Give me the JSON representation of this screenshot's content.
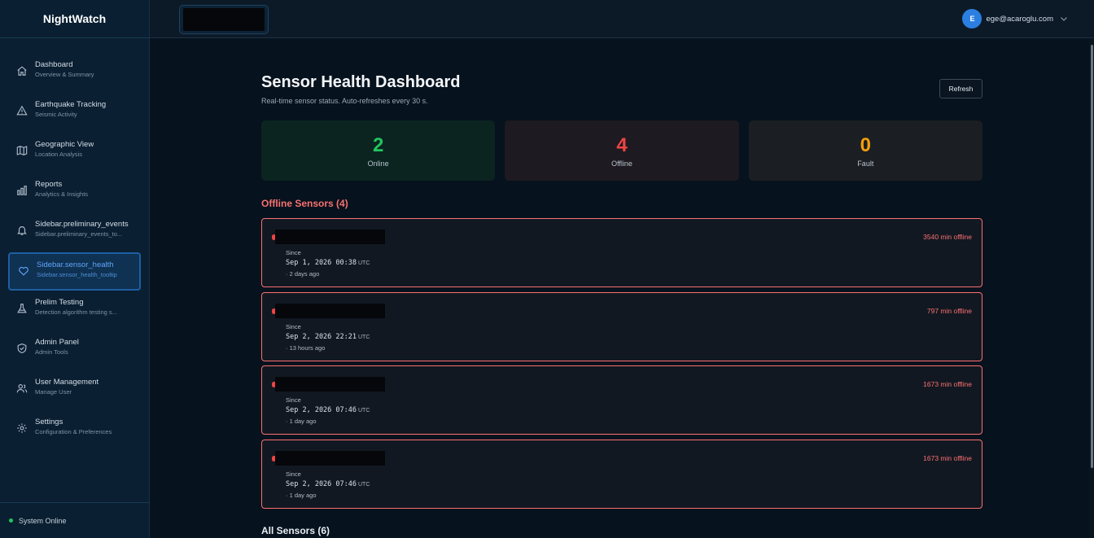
{
  "sidebar": {
    "brand": "NightWatch",
    "items": [
      {
        "title": "Dashboard",
        "subtitle": "Overview & Summary",
        "icon": "home-icon"
      },
      {
        "title": "Earthquake Tracking",
        "subtitle": "Seismic Activity",
        "icon": "warning-triangle-icon"
      },
      {
        "title": "Geographic View",
        "subtitle": "Location Analysis",
        "icon": "map-icon"
      },
      {
        "title": "Reports",
        "subtitle": "Analytics & Insights",
        "icon": "bar-chart-icon"
      },
      {
        "title": "Sidebar.preliminary_events",
        "subtitle": "Sidebar.preliminary_events_to...",
        "icon": "bell-icon"
      },
      {
        "title": "Sidebar.sensor_health",
        "subtitle": "Sidebar.sensor_health_tooltip",
        "icon": "heart-icon",
        "active": true
      },
      {
        "title": "Prelim Testing",
        "subtitle": "Detection algorithm testing s...",
        "icon": "flask-icon"
      },
      {
        "title": "Admin Panel",
        "subtitle": "Admin Tools",
        "icon": "shield-check-icon"
      },
      {
        "title": "User Management",
        "subtitle": "Manage User",
        "icon": "users-icon"
      },
      {
        "title": "Settings",
        "subtitle": "Configuration & Preferences",
        "icon": "gear-icon"
      }
    ],
    "status": "System Online"
  },
  "header": {
    "user_initial": "E",
    "user_email": "ege@acaroglu.com"
  },
  "main": {
    "title": "Sensor Health Dashboard",
    "subtitle": "Real-time sensor status. Auto-refreshes every 30 s.",
    "refresh_label": "Refresh",
    "stats": [
      {
        "value": "2",
        "label": "Online",
        "color": "#22c55e"
      },
      {
        "value": "4",
        "label": "Offline",
        "color": "#ef4444"
      },
      {
        "value": "0",
        "label": "Fault",
        "color": "#f59e0b"
      }
    ],
    "offline_title": "Offline Sensors (4)",
    "offline_sensors": [
      {
        "since_label": "Since",
        "date": "Sep 1, 2026 00:38",
        "tz": "UTC",
        "ago": "· 2 days ago",
        "offline": "3540 min offline"
      },
      {
        "since_label": "Since",
        "date": "Sep 2, 2026 22:21",
        "tz": "UTC",
        "ago": "· 13 hours ago",
        "offline": "797 min offline"
      },
      {
        "since_label": "Since",
        "date": "Sep 2, 2026 07:46",
        "tz": "UTC",
        "ago": "· 1 day ago",
        "offline": "1673 min offline"
      },
      {
        "since_label": "Since",
        "date": "Sep 2, 2026 07:46",
        "tz": "UTC",
        "ago": "· 1 day ago",
        "offline": "1673 min offline"
      }
    ],
    "all_title": "All Sensors (6)"
  }
}
